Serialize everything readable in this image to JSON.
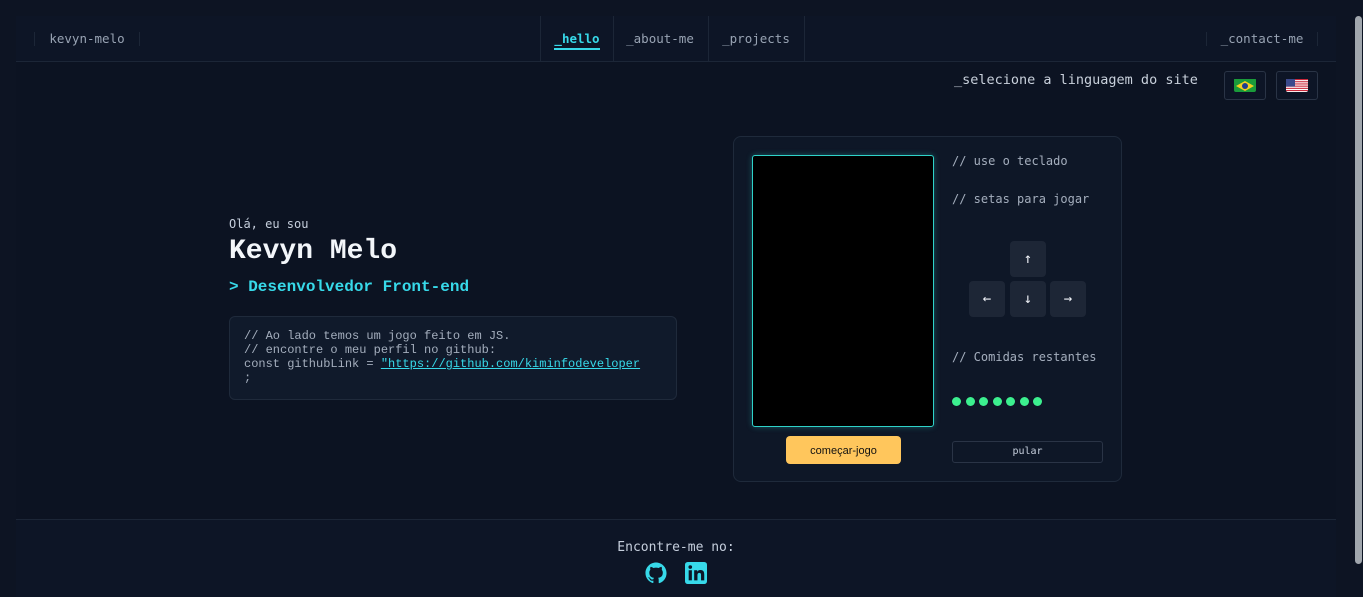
{
  "header": {
    "brand": "kevyn-melo",
    "nav": [
      "_hello",
      "_about-me",
      "_projects"
    ],
    "contact": "_contact-me"
  },
  "language": {
    "label": "_selecione a linguagem do site",
    "options": [
      "br-flag-icon",
      "us-flag-icon"
    ]
  },
  "hero": {
    "greeting": "Olá, eu sou",
    "name": "Kevyn Melo",
    "role": "> Desenvolvedor Front-end",
    "code": {
      "line1": "// Ao lado temos um jogo feito em JS.",
      "line2": "// encontre o meu perfil no github:",
      "line3_prefix": "const githubLink = ",
      "link": "\"https://github.com/kiminfodeveloper",
      "line4": ";"
    }
  },
  "game": {
    "start_label": "começar-jogo",
    "hint1": "// use o teclado",
    "hint2": "// setas para jogar",
    "keys": {
      "up": "↑",
      "left": "←",
      "down": "↓",
      "right": "→"
    },
    "food_label": "// Comidas restantes",
    "food_remaining": 7,
    "skip_label": "pular"
  },
  "footer": {
    "label": "Encontre-me no:",
    "icons": [
      "github-icon",
      "linkedin-icon"
    ]
  },
  "colors": {
    "accent": "#37d9e9",
    "start_button": "#ffc65c",
    "food": "#3cf08f"
  }
}
